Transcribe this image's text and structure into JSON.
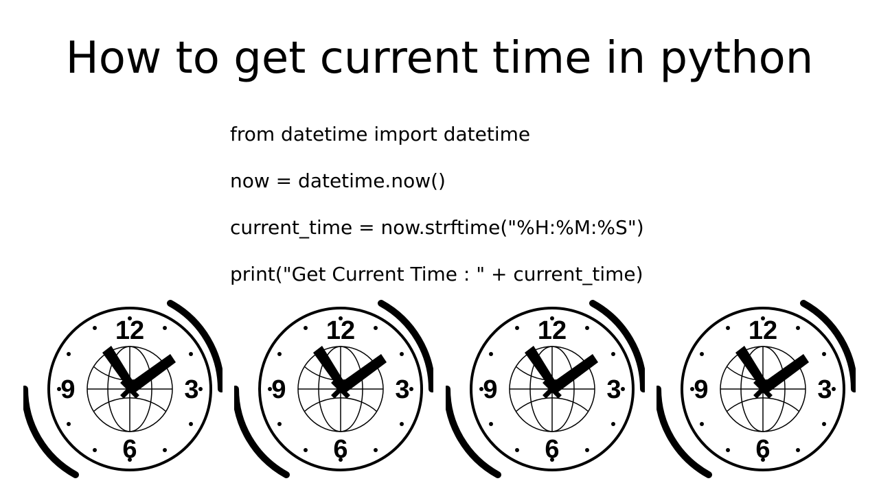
{
  "title": "How to get current time in python",
  "code": {
    "line1": "from datetime import datetime",
    "line2": "now = datetime.now()",
    "line3": "current_time = now.strftime(\"%H:%M:%S\")",
    "line4": "print(\"Get Current Time : \" + current_time)"
  },
  "clocks": {
    "count": 4,
    "numerals": {
      "n12": "12",
      "n3": "3",
      "n6": "6",
      "n9": "9"
    }
  }
}
